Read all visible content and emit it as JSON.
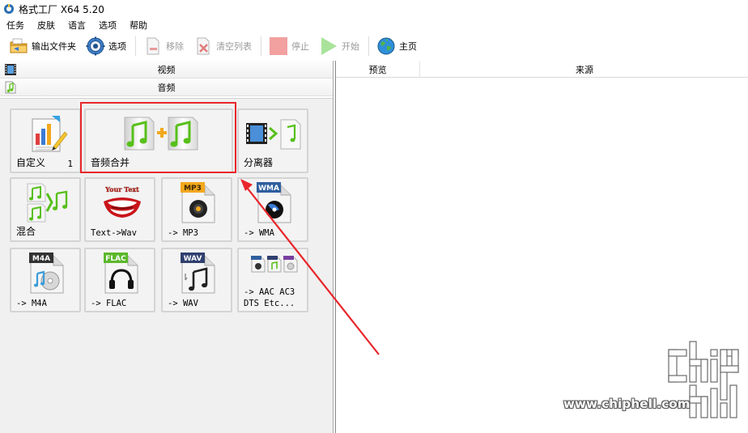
{
  "window": {
    "title": "格式工厂 X64 5.20"
  },
  "menu": {
    "items": [
      "任务",
      "皮肤",
      "语言",
      "选项",
      "帮助"
    ]
  },
  "toolbar": {
    "output_folder": "输出文件夹",
    "options": "选项",
    "remove": "移除",
    "clear_list": "清空列表",
    "stop": "停止",
    "start": "开始",
    "home": "主页"
  },
  "categories": {
    "video": "视频",
    "audio": "音频"
  },
  "tiles": {
    "custom": {
      "label": "自定义",
      "count": "1"
    },
    "audio_merge": {
      "label": "音频合并"
    },
    "splitter": {
      "label": "分离器"
    },
    "mix": {
      "label": "混合"
    },
    "text_to_wav": {
      "label": "Text->Wav",
      "badge": "Your Text"
    },
    "to_mp3": {
      "label": "-> MP3",
      "badge": "MP3"
    },
    "to_wma": {
      "label": "-> WMA",
      "badge": "WMA"
    },
    "to_m4a": {
      "label": "-> M4A",
      "badge": "M4A"
    },
    "to_flac": {
      "label": "-> FLAC",
      "badge": "FLAC"
    },
    "to_wav": {
      "label": "-> WAV",
      "badge": "WAV"
    },
    "to_aac": {
      "label_line1": "-> AAC AC3",
      "label_line2": "DTS Etc..."
    }
  },
  "list": {
    "col_preview": "预览",
    "col_source": "来源"
  },
  "watermark": {
    "text": "www.chiphell.com"
  },
  "colors": {
    "highlight": "#e8262b",
    "music_green": "#5fc21e",
    "arrow_red": "#e8262b"
  }
}
